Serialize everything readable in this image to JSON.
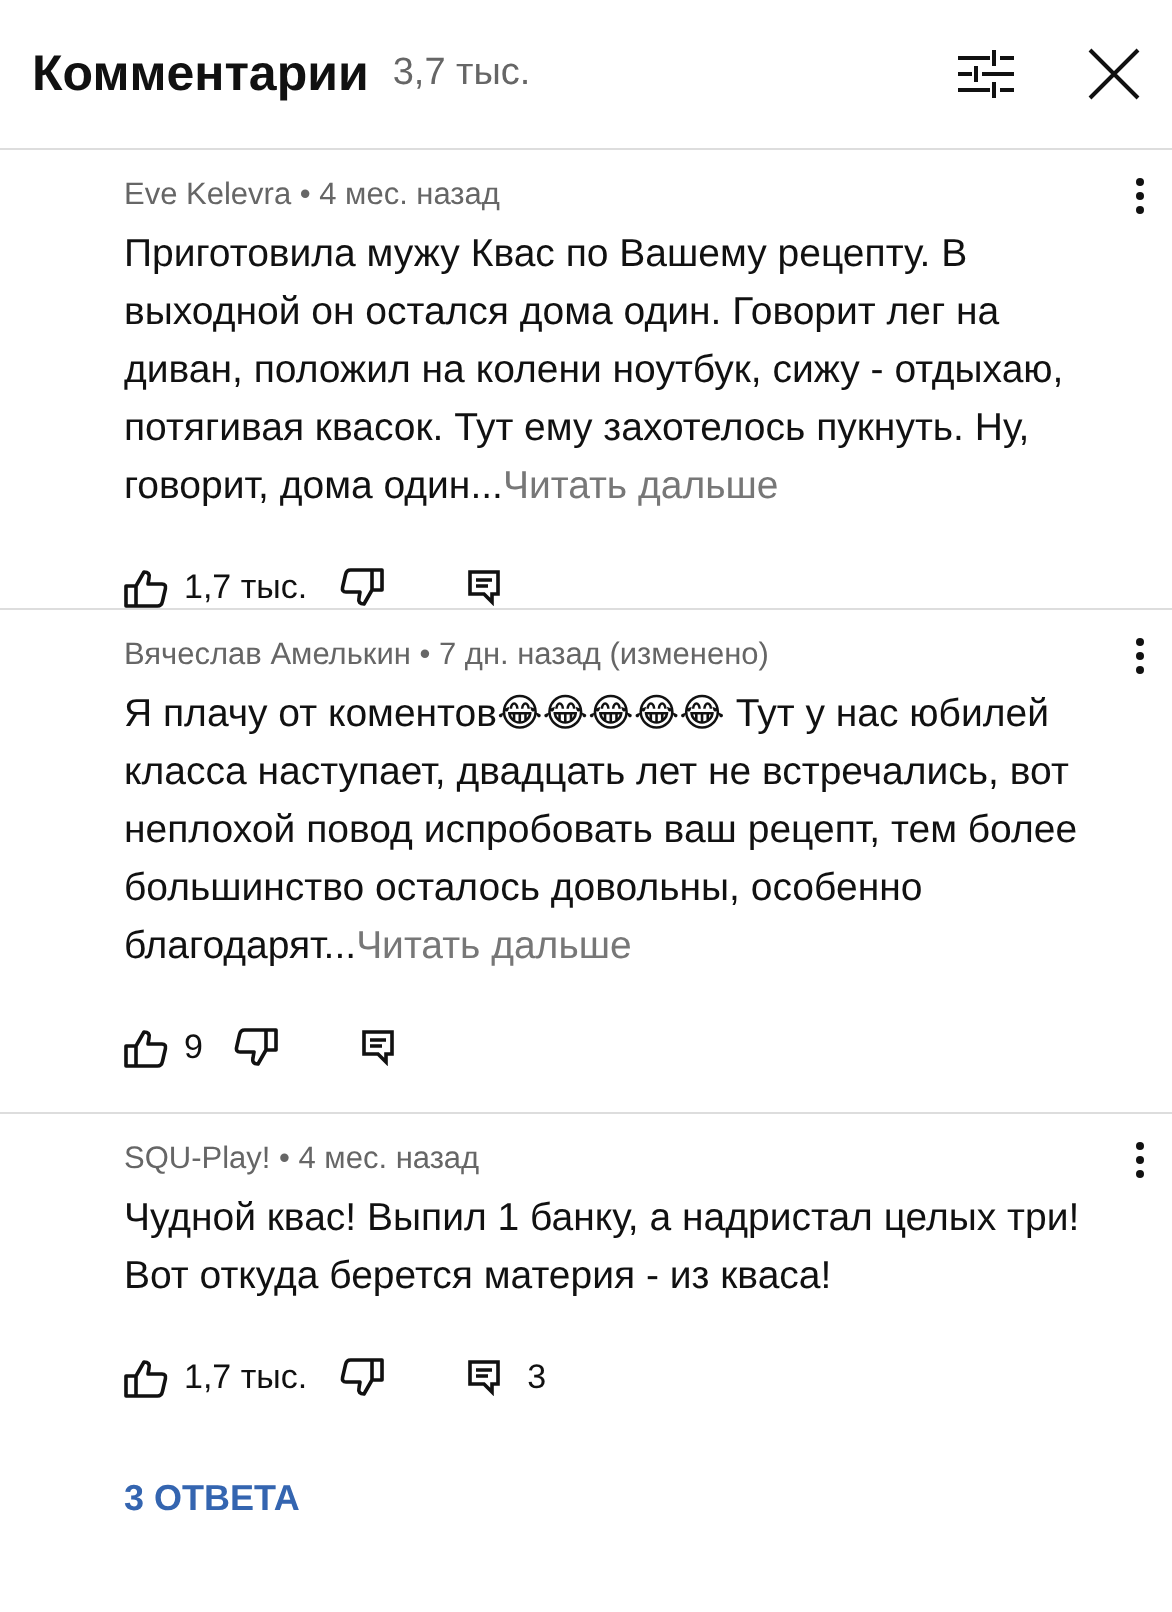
{
  "header": {
    "title": "Комментарии",
    "count": "3,7 тыс."
  },
  "comments": [
    {
      "meta": "Eve Kelevra • 4 мес. назад",
      "text": "Приготовила мужу Квас по Вашему рецепту. В выходной он остался дома один. Говорит лег на диван, положил на колени ноутбук, сижу - отдыхаю, потягивая квасок. Тут ему захотелось пукнуть. Ну, говорит, дома один...",
      "more": "Читать дальше",
      "likes": "1,7 тыс."
    },
    {
      "meta": "Вячеслав Амелькин • 7 дн. назад (изменено)",
      "text": "Я плачу от коментов😂😂😂😂😂 Тут у нас юбилей класса наступает, двадцать лет не встречались, вот неплохой повод испробовать ваш рецепт, тем более большинство осталось довольны, особенно благодарят...",
      "more": "Читать дальше",
      "likes": "9"
    },
    {
      "meta": "SQU-Play! • 4 мес. назад",
      "text": "Чудной квас! Выпил 1 банку, а надристал целых три! Вот откуда берется материя - из кваса!",
      "likes": "1,7 тыс.",
      "reply_count": "3",
      "replies": "3 ОТВЕТА"
    }
  ]
}
